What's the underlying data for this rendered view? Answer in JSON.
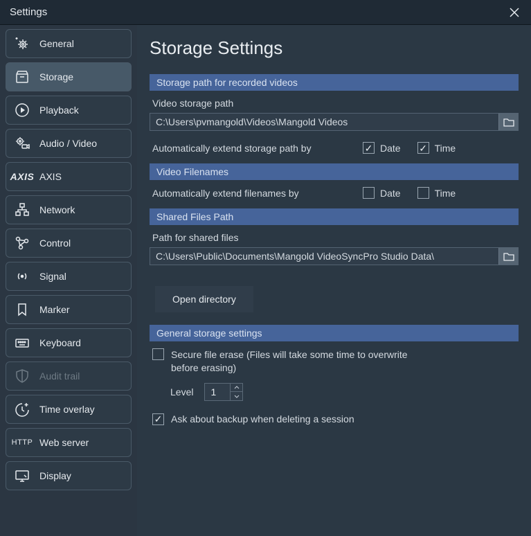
{
  "window": {
    "title": "Settings"
  },
  "sidebar": {
    "items": [
      {
        "label": "General"
      },
      {
        "label": "Storage"
      },
      {
        "label": "Playback"
      },
      {
        "label": "Audio / Video"
      },
      {
        "label": "AXIS"
      },
      {
        "label": "Network"
      },
      {
        "label": "Control"
      },
      {
        "label": "Signal"
      },
      {
        "label": "Marker"
      },
      {
        "label": "Keyboard"
      },
      {
        "label": "Audit trail"
      },
      {
        "label": "Time overlay"
      },
      {
        "label": "Web server"
      },
      {
        "label": "Display"
      }
    ],
    "axis_brand": "AXIS",
    "http_brand": "HTTP"
  },
  "page": {
    "title": "Storage Settings"
  },
  "sections": {
    "storage_path": {
      "header": "Storage path for recorded videos",
      "field_label": "Video storage path",
      "path": "C:\\Users\\pvmangold\\Videos\\Mangold Videos",
      "extend_label": "Automatically extend storage path by",
      "date_label": "Date",
      "time_label": "Time",
      "date_checked": true,
      "time_checked": true
    },
    "filenames": {
      "header": "Video Filenames",
      "extend_label": "Automatically extend filenames by",
      "date_label": "Date",
      "time_label": "Time",
      "date_checked": false,
      "time_checked": false
    },
    "shared": {
      "header": "Shared Files Path",
      "field_label": "Path for shared files",
      "path": "C:\\Users\\Public\\Documents\\Mangold VideoSyncPro Studio Data\\",
      "open_btn": "Open directory"
    },
    "general": {
      "header": "General storage settings",
      "secure_label": "Secure file erase (Files will take some time to overwrite before erasing)",
      "secure_checked": false,
      "level_label": "Level",
      "level_value": "1",
      "backup_label": "Ask about backup when deleting a session",
      "backup_checked": true
    }
  }
}
